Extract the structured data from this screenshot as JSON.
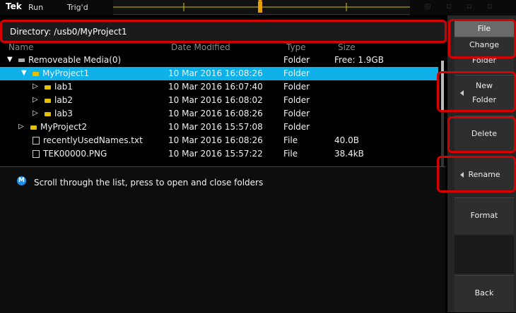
{
  "topbar": {
    "logo": "Tek",
    "run": "Run",
    "trig": "Trig'd"
  },
  "directory": {
    "label": "Directory: /usb0/MyProject1"
  },
  "columns": {
    "name": "Name",
    "date": "Date Modified",
    "type": "Type",
    "size": "Size"
  },
  "rows": [
    {
      "name": "Removeable Media(0)",
      "date": "",
      "type": "Folder",
      "size": "Free: 1.9GB"
    },
    {
      "name": "MyProject1",
      "date": "10 Mar 2016 16:08:26",
      "type": "Folder",
      "size": ""
    },
    {
      "name": "lab1",
      "date": "10 Mar 2016 16:07:40",
      "type": "Folder",
      "size": ""
    },
    {
      "name": "lab2",
      "date": "10 Mar 2016 16:08:02",
      "type": "Folder",
      "size": ""
    },
    {
      "name": "lab3",
      "date": "10 Mar 2016 16:08:26",
      "type": "Folder",
      "size": ""
    },
    {
      "name": "MyProject2",
      "date": "10 Mar 2016 15:57:08",
      "type": "Folder",
      "size": ""
    },
    {
      "name": "recentlyUsedNames.txt",
      "date": "10 Mar 2016 16:08:26",
      "type": "File",
      "size": "40.0B"
    },
    {
      "name": "TEK00000.PNG",
      "date": "10 Mar 2016 15:57:22",
      "type": "File",
      "size": "38.4kB"
    }
  ],
  "hint": {
    "icon_letter": "M",
    "text": "Scroll through the list, press to open and close folders"
  },
  "sidebar": {
    "file": "File",
    "change_l1": "Change",
    "change_l2": "Folder",
    "new_l1": "New",
    "new_l2": "Folder",
    "delete": "Delete",
    "rename": "Rename",
    "format": "Format",
    "back": "Back"
  },
  "colors": {
    "selection": "#0fb1e8",
    "highlight_box": "#d70000",
    "folder": "#e5c000"
  }
}
